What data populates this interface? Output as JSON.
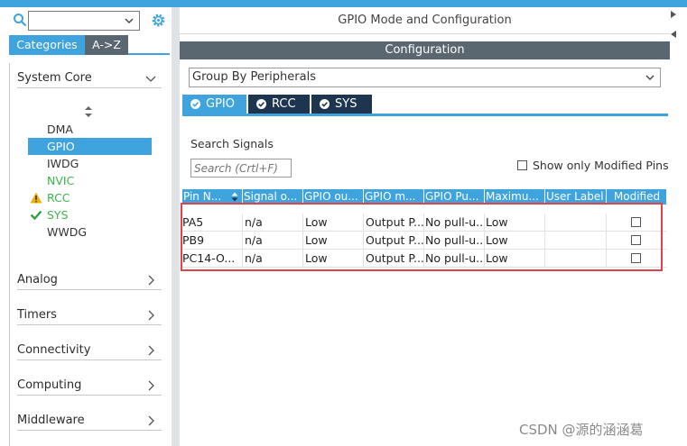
{
  "sidebar": {
    "filter_value": "",
    "tabs": {
      "categories": "Categories",
      "az": "A->Z"
    },
    "sections": {
      "system_core": "System Core",
      "analog": "Analog",
      "timers": "Timers",
      "connectivity": "Connectivity",
      "computing": "Computing",
      "middleware": "Middleware"
    },
    "items": [
      {
        "label": "DMA",
        "state": "normal"
      },
      {
        "label": "GPIO",
        "state": "selected"
      },
      {
        "label": "IWDG",
        "state": "normal"
      },
      {
        "label": "NVIC",
        "state": "configured"
      },
      {
        "label": "RCC",
        "state": "warning"
      },
      {
        "label": "SYS",
        "state": "ok"
      },
      {
        "label": "WWDG",
        "state": "normal"
      }
    ]
  },
  "main": {
    "title": "GPIO Mode and Configuration",
    "config_header": "Configuration",
    "group_by": "Group By Peripherals",
    "tabs": [
      "GPIO",
      "RCC",
      "SYS"
    ],
    "search_label": "Search Signals",
    "search_placeholder": "Search (Crtl+F)",
    "show_modified_label": "Show only Modified Pins",
    "table": {
      "columns": [
        "Pin N...",
        "Signal o...",
        "GPIO ou...",
        "GPIO m...",
        "GPIO Pu...",
        "Maximu...",
        "User Label",
        "Modified"
      ],
      "rows": [
        [
          "PA5",
          "n/a",
          "Low",
          "Output P...",
          "No pull-u...",
          "Low",
          "",
          false
        ],
        [
          "PB9",
          "n/a",
          "Low",
          "Output P...",
          "No pull-u...",
          "Low",
          "",
          false
        ],
        [
          "PC14-O...",
          "n/a",
          "Low",
          "Output P...",
          "No pull-u...",
          "Low",
          "",
          false
        ]
      ]
    }
  },
  "watermark": "CSDN @源的涵涵葛",
  "colors": {
    "accent": "#3fa3dd",
    "dark_tab": "#1e3550",
    "header_gray": "#5b6770",
    "ok_green": "#2ea043",
    "configured_green": "#3ab54a",
    "warning_yellow": "#f0b400",
    "highlight_red": "#e0434b"
  }
}
